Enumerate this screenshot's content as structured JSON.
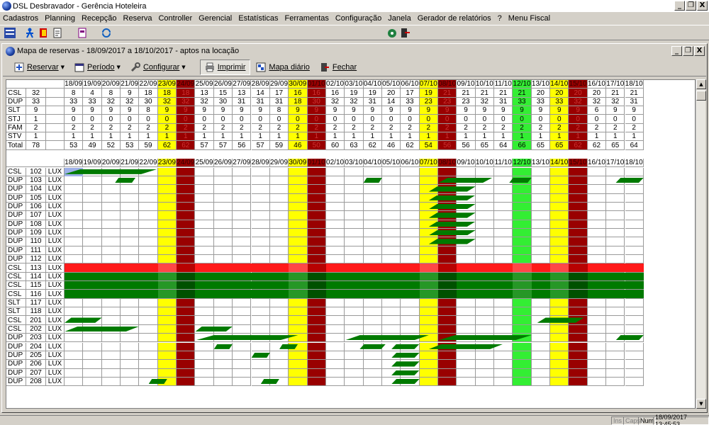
{
  "app": {
    "title": "DSL Desbravador - Gerência Hoteleira"
  },
  "menu": [
    "Cadastros",
    "Planning",
    "Recepção",
    "Reserva",
    "Controller",
    "Gerencial",
    "Estatísticas",
    "Ferramentas",
    "Configuração",
    "Janela",
    "Gerador de relatórios",
    "?",
    "Menu Fiscal"
  ],
  "window_buttons": {
    "minimize": "_",
    "restore": "❐",
    "close": "X"
  },
  "child": {
    "title": "Mapa de reservas - 18/09/2017 a 18/10/2017 - aptos na locação",
    "toolbar": [
      {
        "label": "Reservar",
        "icon": "plus-icon",
        "dropdown": true
      },
      {
        "label": "Período",
        "icon": "calendar-icon",
        "dropdown": true
      },
      {
        "label": "Configurar",
        "icon": "wrench-icon",
        "dropdown": true
      },
      {
        "label": "Imprimir",
        "icon": "printer-icon",
        "dropdown": false,
        "pressed": true
      },
      {
        "label": "Mapa diário",
        "icon": "map-icon",
        "dropdown": false
      },
      {
        "label": "Fechar",
        "icon": "door-icon",
        "dropdown": false
      }
    ]
  },
  "dates": [
    "18/09",
    "19/09",
    "20/09",
    "21/09",
    "22/09",
    "23/09",
    "24/09",
    "25/09",
    "26/09",
    "27/09",
    "28/09",
    "29/09",
    "30/09",
    "01/10",
    "02/10",
    "03/10",
    "04/10",
    "05/10",
    "06/10",
    "07/10",
    "08/10",
    "09/10",
    "10/10",
    "11/10",
    "12/10",
    "13/10",
    "14/10",
    "15/10",
    "16/10",
    "17/10",
    "18/10"
  ],
  "date_status": [
    "",
    "",
    "",
    "",
    "",
    "sat",
    "sun",
    "",
    "",
    "",
    "",
    "",
    "sat",
    "sun",
    "",
    "",
    "",
    "",
    "",
    "sat",
    "sun",
    "",
    "",
    "",
    "hol",
    "",
    "sat",
    "sun",
    "",
    "",
    ""
  ],
  "colors": {
    "sat": "#ffff00",
    "sun": "#990000",
    "hol": "#33ee33",
    "bar_green": "#007a00",
    "bar_red": "#ff1a1a",
    "header_gray": "#d4d0c8"
  },
  "summary": {
    "rows": [
      {
        "type": "CSL",
        "count": "32",
        "values": [
          8,
          4,
          8,
          9,
          18,
          18,
          18,
          13,
          15,
          13,
          14,
          17,
          16,
          16,
          16,
          19,
          19,
          20,
          17,
          19,
          21,
          21,
          21,
          21,
          21,
          20,
          20,
          20,
          20,
          21,
          21
        ]
      },
      {
        "type": "DUP",
        "count": "33",
        "values": [
          33,
          33,
          32,
          32,
          30,
          32,
          32,
          32,
          30,
          31,
          31,
          31,
          18,
          30,
          32,
          32,
          31,
          14,
          33,
          23,
          23,
          23,
          32,
          31,
          33,
          33,
          33,
          32,
          32,
          32,
          31
        ]
      },
      {
        "type": "SLT",
        "count": "9",
        "values": [
          9,
          9,
          9,
          9,
          8,
          9,
          9,
          9,
          9,
          9,
          9,
          8,
          9,
          9,
          9,
          9,
          9,
          9,
          9,
          9,
          9,
          9,
          9,
          9,
          9,
          9,
          9,
          9,
          6,
          9,
          9
        ]
      },
      {
        "type": "STJ",
        "count": "1",
        "values": [
          0,
          0,
          0,
          0,
          0,
          0,
          0,
          0,
          0,
          0,
          0,
          0,
          0,
          0,
          0,
          0,
          0,
          0,
          0,
          0,
          0,
          0,
          0,
          0,
          0,
          0,
          0,
          0,
          0,
          0,
          0
        ]
      },
      {
        "type": "FAM",
        "count": "2",
        "values": [
          2,
          2,
          2,
          2,
          2,
          2,
          2,
          2,
          2,
          2,
          2,
          2,
          2,
          2,
          2,
          2,
          2,
          2,
          2,
          2,
          2,
          2,
          2,
          2,
          2,
          2,
          2,
          2,
          2,
          2,
          2
        ]
      },
      {
        "type": "STV",
        "count": "1",
        "values": [
          1,
          1,
          1,
          1,
          1,
          1,
          1,
          1,
          1,
          1,
          1,
          1,
          1,
          1,
          1,
          1,
          1,
          1,
          1,
          1,
          1,
          1,
          1,
          1,
          1,
          1,
          1,
          1,
          1,
          1,
          1
        ]
      }
    ],
    "total": {
      "label": "Total",
      "count": "78",
      "values": [
        53,
        49,
        52,
        53,
        59,
        62,
        62,
        57,
        57,
        56,
        57,
        59,
        46,
        50,
        60,
        63,
        62,
        46,
        62,
        54,
        56,
        56,
        65,
        64,
        66,
        65,
        65,
        62,
        62,
        65,
        64
      ]
    }
  },
  "rooms": [
    {
      "type": "CSL",
      "number": "102",
      "category": "LUX",
      "bars": [
        {
          "s": 0,
          "e": 5,
          "c": "g",
          "sl": 1
        }
      ]
    },
    {
      "type": "DUP",
      "number": "103",
      "category": "LUX",
      "bars": [
        {
          "s": 2.7,
          "e": 3.8,
          "c": "g",
          "sl": 1
        },
        {
          "s": 16,
          "e": 17,
          "c": "g",
          "sl": 1
        },
        {
          "s": 20,
          "e": 22.9,
          "c": "g",
          "sl": 1
        },
        {
          "s": 23.8,
          "e": 25,
          "c": "g",
          "sl": 1
        },
        {
          "s": 29.5,
          "e": 31,
          "c": "g",
          "sl": 1
        }
      ]
    },
    {
      "type": "DUP",
      "number": "104",
      "category": "LUX",
      "bars": [
        {
          "s": 19.5,
          "e": 22,
          "c": "g",
          "sl": 1
        }
      ]
    },
    {
      "type": "DUP",
      "number": "105",
      "category": "LUX",
      "bars": [
        {
          "s": 19.5,
          "e": 22,
          "c": "g",
          "sl": 1
        }
      ]
    },
    {
      "type": "DUP",
      "number": "106",
      "category": "LUX",
      "bars": [
        {
          "s": 19.5,
          "e": 22,
          "c": "g",
          "sl": 1
        }
      ]
    },
    {
      "type": "DUP",
      "number": "107",
      "category": "LUX",
      "bars": [
        {
          "s": 19.5,
          "e": 22,
          "c": "g",
          "sl": 1
        }
      ]
    },
    {
      "type": "DUP",
      "number": "108",
      "category": "LUX",
      "bars": [
        {
          "s": 19.5,
          "e": 22,
          "c": "g",
          "sl": 1
        }
      ]
    },
    {
      "type": "DUP",
      "number": "109",
      "category": "LUX",
      "bars": [
        {
          "s": 19.5,
          "e": 22,
          "c": "g",
          "sl": 1
        }
      ]
    },
    {
      "type": "DUP",
      "number": "110",
      "category": "LUX",
      "bars": [
        {
          "s": 19.5,
          "e": 22,
          "c": "g",
          "sl": 1
        }
      ]
    },
    {
      "type": "DUP",
      "number": "111",
      "category": "LUX",
      "bars": []
    },
    {
      "type": "DUP",
      "number": "112",
      "category": "LUX",
      "bars": []
    },
    {
      "type": "CSL",
      "number": "113",
      "category": "LUX",
      "bars": [
        {
          "s": 0,
          "e": 31,
          "c": "r",
          "sl": 0
        }
      ]
    },
    {
      "type": "CSL",
      "number": "114",
      "category": "LUX",
      "bars": [
        {
          "s": 0,
          "e": 31,
          "c": "g",
          "sl": 0
        }
      ]
    },
    {
      "type": "CSL",
      "number": "115",
      "category": "LUX",
      "bars": [
        {
          "s": 0,
          "e": 31,
          "c": "g",
          "sl": 0
        }
      ]
    },
    {
      "type": "CSL",
      "number": "116",
      "category": "LUX",
      "bars": [
        {
          "s": 0,
          "e": 31,
          "c": "g",
          "sl": 0
        }
      ]
    },
    {
      "type": "SLT",
      "number": "117",
      "category": "LUX",
      "bars": []
    },
    {
      "type": "SLT",
      "number": "118",
      "category": "LUX",
      "bars": []
    },
    {
      "type": "CSL",
      "number": "201",
      "category": "LUX",
      "bars": [
        {
          "s": 0,
          "e": 2,
          "c": "g",
          "sl": 1
        },
        {
          "s": 25.3,
          "e": 27.8,
          "c": "g",
          "sl": 1
        }
      ]
    },
    {
      "type": "CSL",
      "number": "202",
      "category": "LUX",
      "bars": [
        {
          "s": 0,
          "e": 4,
          "c": "g",
          "sl": 1
        },
        {
          "s": 7,
          "e": 9,
          "c": "g",
          "sl": 1
        }
      ]
    },
    {
      "type": "DUP",
      "number": "203",
      "category": "LUX",
      "bars": [
        {
          "s": 7,
          "e": 12.5,
          "c": "g",
          "sl": 1
        },
        {
          "s": 15,
          "e": 19.5,
          "c": "g",
          "sl": 1
        },
        {
          "s": 20,
          "e": 25,
          "c": "g",
          "sl": 1
        },
        {
          "s": 29.5,
          "e": 31,
          "c": "g",
          "sl": 1
        }
      ]
    },
    {
      "type": "DUP",
      "number": "204",
      "category": "LUX",
      "bars": [
        {
          "s": 8,
          "e": 9,
          "c": "g",
          "sl": 1
        },
        {
          "s": 11.5,
          "e": 12.5,
          "c": "g",
          "sl": 1
        },
        {
          "s": 15.8,
          "e": 17.2,
          "c": "g",
          "sl": 1
        },
        {
          "s": 17.5,
          "e": 19,
          "c": "g",
          "sl": 1
        },
        {
          "s": 19.5,
          "e": 23.5,
          "c": "g",
          "sl": 1
        }
      ]
    },
    {
      "type": "DUP",
      "number": "205",
      "category": "LUX",
      "bars": [
        {
          "s": 10,
          "e": 11,
          "c": "g",
          "sl": 1
        },
        {
          "s": 17.5,
          "e": 19,
          "c": "g",
          "sl": 1
        }
      ]
    },
    {
      "type": "DUP",
      "number": "206",
      "category": "LUX",
      "bars": [
        {
          "s": 17.5,
          "e": 19,
          "c": "g",
          "sl": 1
        }
      ]
    },
    {
      "type": "DUP",
      "number": "207",
      "category": "LUX",
      "bars": [
        {
          "s": 17.5,
          "e": 19,
          "c": "g",
          "sl": 1
        }
      ]
    },
    {
      "type": "DUP",
      "number": "208",
      "category": "LUX",
      "bars": [
        {
          "s": 4.5,
          "e": 5.5,
          "c": "g",
          "sl": 1
        },
        {
          "s": 10.5,
          "e": 11.5,
          "c": "g",
          "sl": 1
        },
        {
          "s": 17.5,
          "e": 19,
          "c": "g",
          "sl": 1
        }
      ]
    }
  ],
  "status": {
    "ins": "Ins",
    "caps": "Caps",
    "num": "Num",
    "datetime": "18/09/2017 13:45:53"
  }
}
